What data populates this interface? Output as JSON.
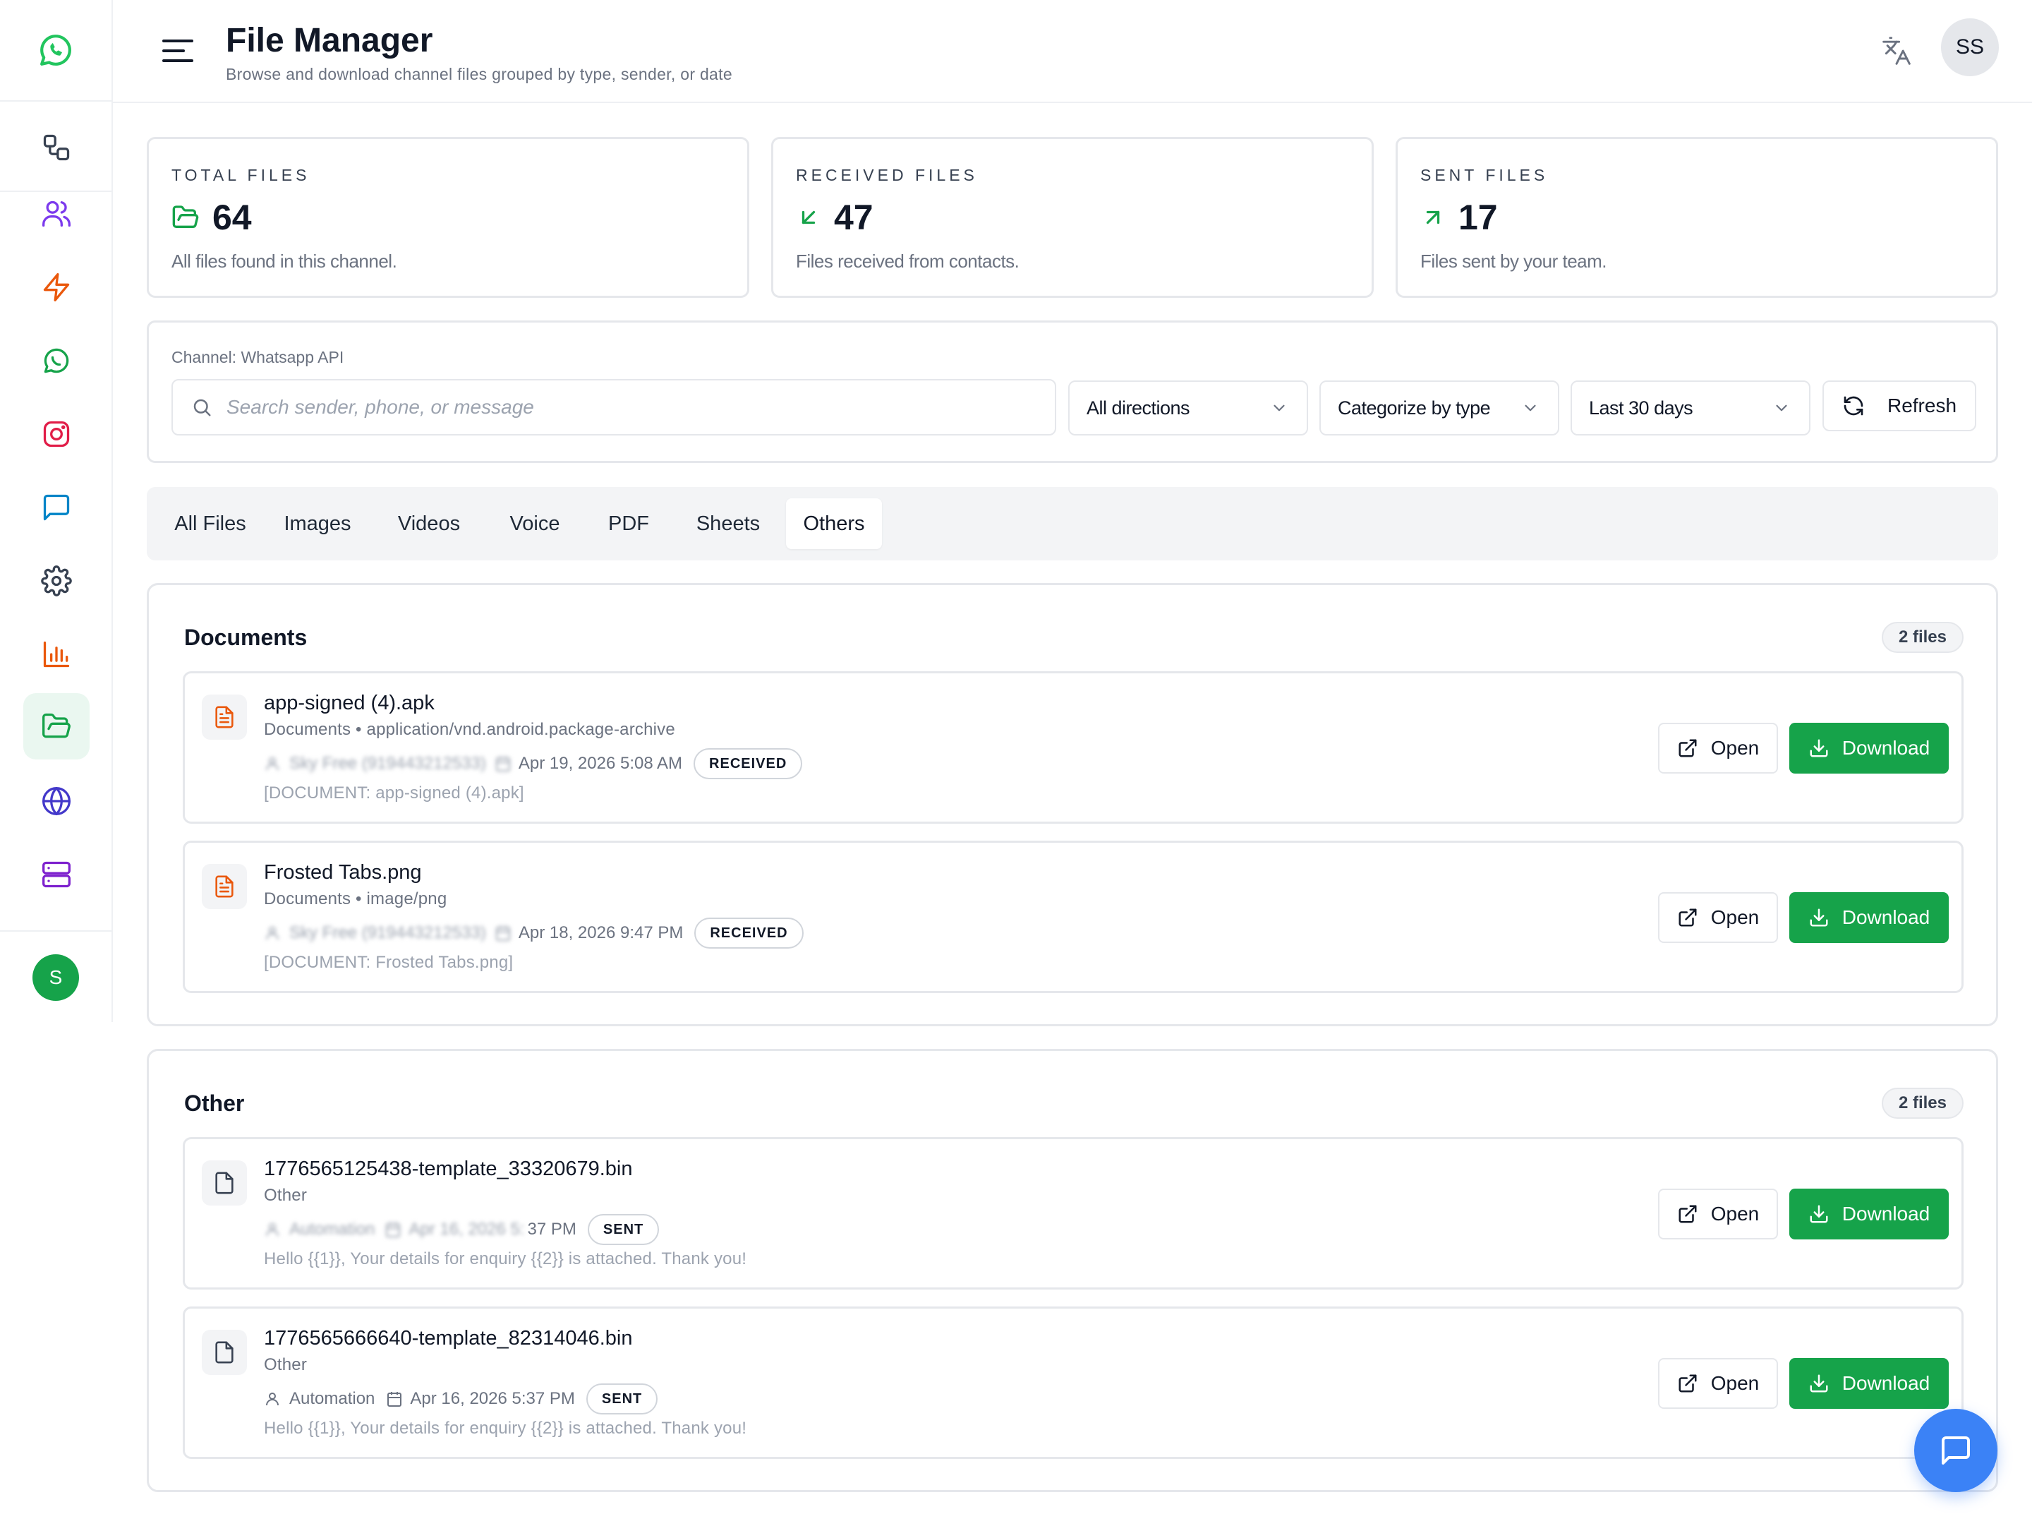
{
  "header": {
    "title": "File Manager",
    "subtitle": "Browse and download channel files grouped by type, sender, or date",
    "user_initials": "SS"
  },
  "sidebar": {
    "user_initial": "S",
    "items": [
      {
        "icon": "workflow-icon",
        "color": "#374151"
      },
      {
        "icon": "users-icon",
        "color": "#7c3aed"
      },
      {
        "icon": "zap-icon",
        "color": "#ea580c"
      },
      {
        "icon": "whatsapp-icon",
        "color": "#16a34a"
      },
      {
        "icon": "instagram-icon",
        "color": "#e11d48"
      },
      {
        "icon": "chat-icon",
        "color": "#0284c7"
      },
      {
        "icon": "settings-icon",
        "color": "#374151"
      },
      {
        "icon": "bar-chart-icon",
        "color": "#ea580c"
      },
      {
        "icon": "folder-open-icon",
        "color": "#16a34a",
        "active": true
      },
      {
        "icon": "globe-icon",
        "color": "#4338ca"
      },
      {
        "icon": "server-icon",
        "color": "#7e22ce"
      }
    ]
  },
  "stats": {
    "total": {
      "label": "TOTAL FILES",
      "value": "64",
      "desc": "All files found in this channel."
    },
    "received": {
      "label": "RECEIVED FILES",
      "value": "47",
      "desc": "Files received from contacts."
    },
    "sent": {
      "label": "SENT FILES",
      "value": "17",
      "desc": "Files sent by your team."
    }
  },
  "filters": {
    "channel": "Channel: Whatsapp API",
    "search_placeholder": "Search sender, phone, or message",
    "direction": "All directions",
    "categorize": "Categorize by type",
    "range": "Last 30 days",
    "refresh": "Refresh"
  },
  "tabs": [
    "All Files",
    "Images",
    "Videos",
    "Voice",
    "PDF",
    "Sheets",
    "Others"
  ],
  "active_tab": "Others",
  "actions": {
    "open": "Open",
    "download": "Download"
  },
  "groups": [
    {
      "title": "Documents",
      "count": "2 files",
      "files": [
        {
          "name": "app-signed (4).apk",
          "type": "Documents • application/vnd.android.package-archive",
          "sender": "Sky Free (919443212533)",
          "date": "Apr 19, 2026 5:08 AM",
          "direction": "RECEIVED",
          "message": "[DOCUMENT: app-signed (4).apk]"
        },
        {
          "name": "Frosted Tabs.png",
          "type": "Documents • image/png",
          "sender": "Sky Free (919443212533)",
          "date": "Apr 18, 2026 9:47 PM",
          "direction": "RECEIVED",
          "message": "[DOCUMENT: Frosted Tabs.png]"
        }
      ]
    },
    {
      "title": "Other",
      "count": "2 files",
      "files": [
        {
          "name": "1776565125438-template_33320679.bin",
          "type": "Other",
          "sender": "Automation",
          "date_blurred": "Apr 16, 2026 5:",
          "date_visible": "37 PM",
          "direction": "SENT",
          "message": "Hello {{1}}, Your details for enquiry {{2}} is attached. Thank you!"
        },
        {
          "name": "1776565666640-template_82314046.bin",
          "type": "Other",
          "sender": "Automation",
          "date": "Apr 16, 2026 5:37 PM",
          "direction": "SENT",
          "message": "Hello {{1}}, Your details for enquiry {{2}} is attached. Thank you!"
        }
      ]
    }
  ]
}
